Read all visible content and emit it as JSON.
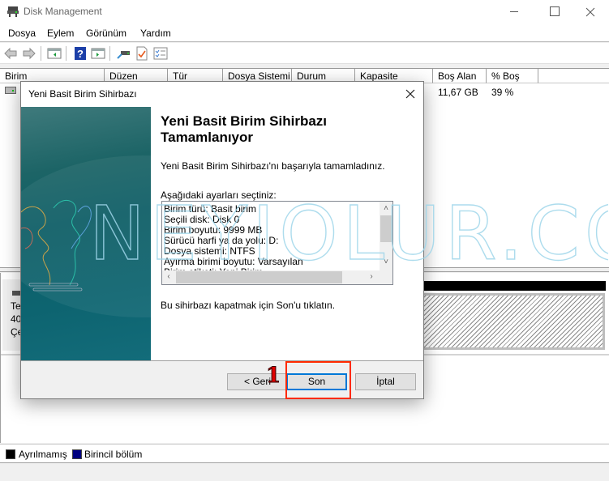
{
  "window": {
    "title": "Disk Management",
    "icon": "disk-management-icon",
    "controls": [
      "minimize-icon",
      "maximize-icon",
      "close-icon"
    ]
  },
  "menu": {
    "items": [
      "Dosya",
      "Eylem",
      "Görünüm",
      "Yardım"
    ]
  },
  "toolbar": {
    "buttons": [
      "back-arrow-icon",
      "forward-arrow-icon",
      "console-tree-icon",
      "help-icon",
      "action-pane-icon",
      "connect-drive-icon",
      "checklist-doc-icon",
      "properties-list-icon"
    ]
  },
  "volume_list": {
    "columns": [
      "Birim",
      "Düzen",
      "Tür",
      "Dosya Sistemi",
      "Durum",
      "Kapasite",
      "Boş Alan",
      "% Boş"
    ],
    "rows": [
      {
        "birim": "",
        "duzen": "",
        "tur": "",
        "dosya_sistemi": "",
        "durum": "",
        "kapasite": "",
        "bos_alan": "11,67 GB",
        "yuzde_bos": "39 %"
      }
    ]
  },
  "disk_area": {
    "disk_label_lines": [
      "Te",
      "40,",
      "Çe"
    ],
    "unallocated_color": "#000000"
  },
  "legend": {
    "items": [
      {
        "label": "Ayrılmamış",
        "color": "#000000"
      },
      {
        "label": "Birincil bölüm",
        "color": "#000080"
      }
    ]
  },
  "watermark": {
    "text": "NEYIOLUR.COM"
  },
  "wizard": {
    "title": "Yeni Basit Birim Sihirbazı",
    "heading": "Yeni Basit Birim Sihirbazı Tamamlanıyor",
    "success_text": "Yeni Basit Birim Sihirbazı'nı başarıyla tamamladınız.",
    "settings_label": "Aşağıdaki ayarları seçtiniz:",
    "settings": [
      "Birim türü: Basit birim",
      "Seçili disk: Disk 0",
      "Birim boyutu: 9999 MB",
      "Sürücü harfi ya da yolu: D:",
      "Dosya sistemi: NTFS",
      "Ayırma birimi boyutu: Varsayılan",
      "Birim etiketi: Yeni Birim"
    ],
    "close_hint": "Bu sihirbazı kapatmak için Son'u tıklatın.",
    "buttons": {
      "back": "< Geri",
      "finish": "Son",
      "cancel": "İptal"
    },
    "annotation_step": "1",
    "highlight_color": "#ff2a00",
    "accent_color": "#0078d7"
  }
}
